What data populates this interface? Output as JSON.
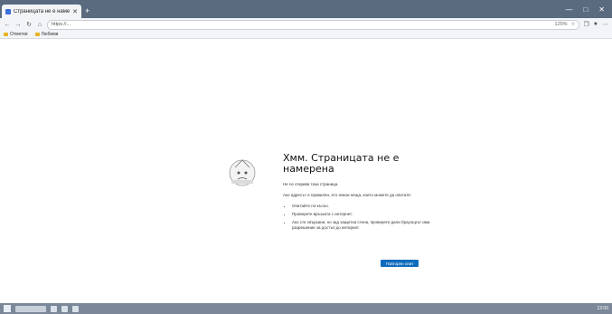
{
  "browser": {
    "tab_title": "Страницата не е намерена",
    "tab_close": "✕",
    "new_tab": "+",
    "window_controls": {
      "minimize": "—",
      "maximize": "□",
      "close": "✕"
    },
    "url": "https://...",
    "zoom": "125%",
    "nav": {
      "back": "←",
      "forward": "→",
      "reload": "↻",
      "home": "⌂"
    }
  },
  "bookmarks": {
    "items": [
      {
        "label": "Отметки"
      },
      {
        "label": "Любими"
      }
    ]
  },
  "error_page": {
    "title": "Хмм. Страницата не е намерена",
    "intro": "Не се открива тази страница.",
    "suggestions_heading": "Ако адресът е правилен, ето някои неща, които можете да опитате:",
    "suggestions": [
      "Опитайте по-късно.",
      "Проверете връзката с интернет.",
      "Ако сте свързани, но зад защитна стена, проверете дали браузърът има разрешение за достъп до интернет."
    ],
    "refresh_label": "Повторен опит"
  },
  "taskbar": {
    "clock": "12:00"
  },
  "colors": {
    "accent": "#0f6cbd",
    "titlebar": "#5a6b80",
    "taskbar": "#7a8899"
  }
}
